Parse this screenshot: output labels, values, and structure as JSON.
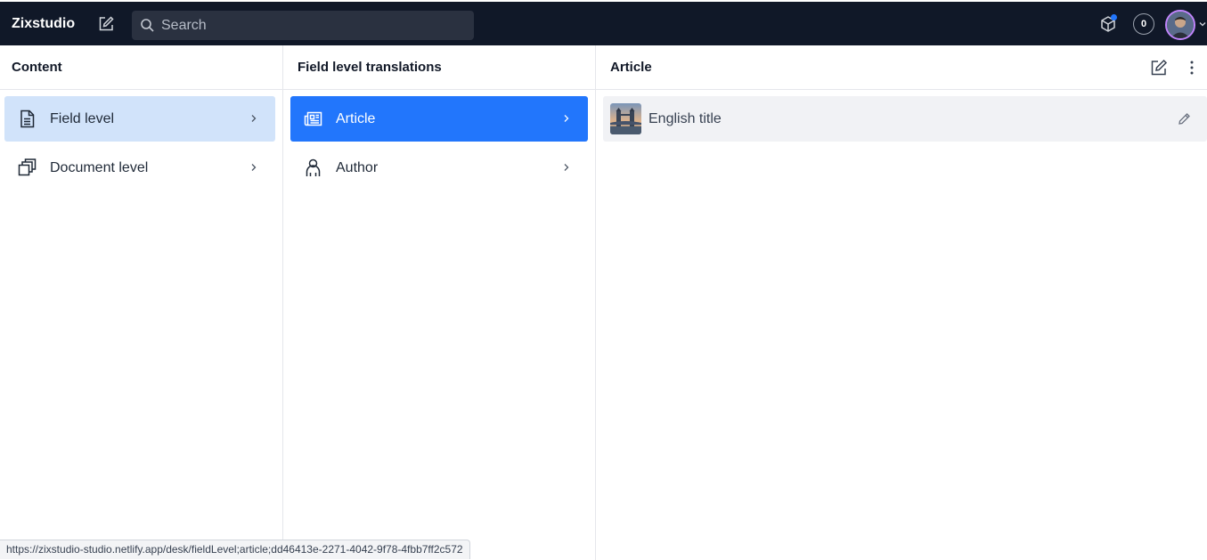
{
  "topbar": {
    "brand": "Zixstudio",
    "search_placeholder": "Search",
    "counter": "0"
  },
  "panes": {
    "content": {
      "title": "Content",
      "items": [
        {
          "label": "Field level",
          "icon": "document-icon"
        },
        {
          "label": "Document level",
          "icon": "documents-icon"
        }
      ]
    },
    "field_level": {
      "title": "Field level translations",
      "items": [
        {
          "label": "Article",
          "icon": "newspaper-icon"
        },
        {
          "label": "Author",
          "icon": "user-icon"
        }
      ]
    },
    "article": {
      "title": "Article",
      "documents": [
        {
          "title": "English title"
        }
      ]
    }
  },
  "status_url": "https://zixstudio-studio.netlify.app/desk/fieldLevel;article;dd46413e-2271-4042-9f78-4fbb7ff2c572",
  "colors": {
    "topbar": "#101828",
    "accent": "#2276fc",
    "selected_light": "#d1e3fa",
    "row_bg": "#f1f2f5"
  }
}
